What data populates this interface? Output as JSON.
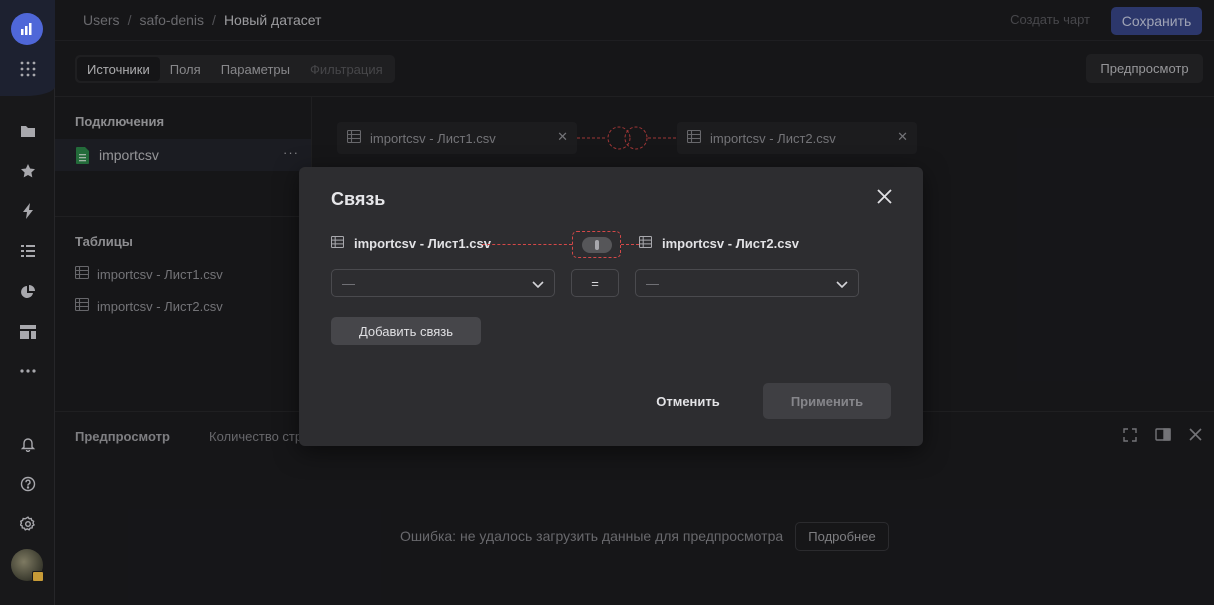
{
  "breadcrumbs": [
    "Users",
    "safo-denis",
    "Новый датасет"
  ],
  "header": {
    "create_chart": "Создать чарт",
    "save": "Сохранить"
  },
  "tabs": [
    {
      "label": "Источники",
      "active": true
    },
    {
      "label": "Поля"
    },
    {
      "label": "Параметры"
    },
    {
      "label": "Фильтрация",
      "disabled": true
    }
  ],
  "preview_button": "Предпросмотр",
  "sources": {
    "connections_title": "Подключения",
    "connection": "importcsv",
    "tables_title": "Таблицы",
    "tables": [
      "importcsv - Лист1.csv",
      "importcsv - Лист2.csv"
    ]
  },
  "canvas": {
    "left_table": "importcsv - Лист1.csv",
    "right_table": "importcsv - Лист2.csv"
  },
  "bottom": {
    "title": "Предпросмотр",
    "row_count_label": "Количество стр",
    "error": "Ошибка: не удалось загрузить данные для предпросмотра",
    "more": "Подробнее"
  },
  "modal": {
    "title": "Связь",
    "left_table": "importcsv - Лист1.csv",
    "right_table": "importcsv - Лист2.csv",
    "left_field": "—",
    "operator": "=",
    "right_field": "—",
    "add_link": "Добавить связь",
    "cancel": "Отменить",
    "apply": "Применить"
  },
  "colors": {
    "accent": "#4f67d8",
    "link_line": "#d54848",
    "background": "#1e1e21"
  }
}
